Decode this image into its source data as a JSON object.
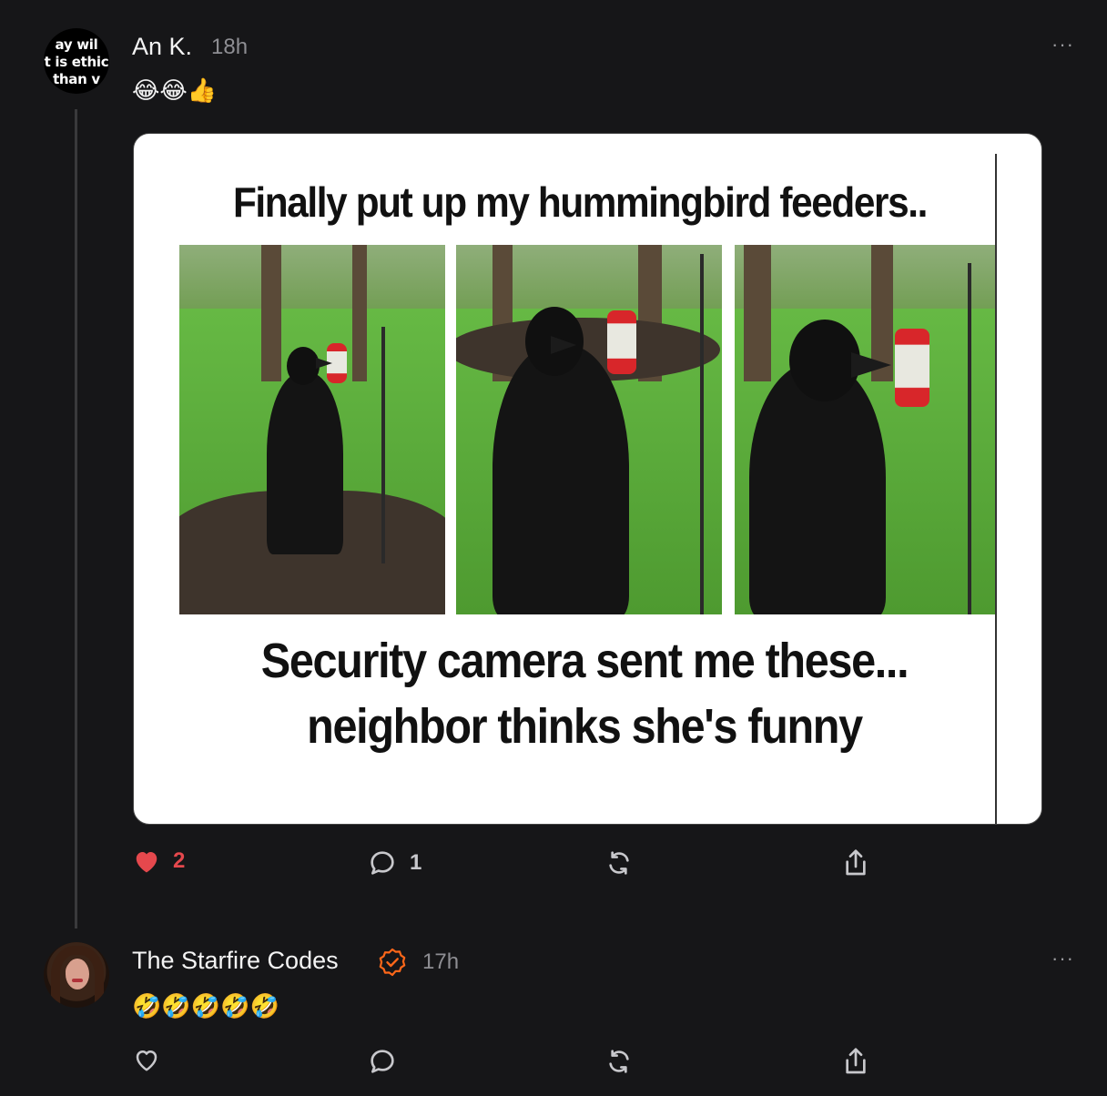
{
  "notes": [
    {
      "avatar_text": "ay wil\nt is ethic\nthan v",
      "author": "An K.",
      "time": "18h",
      "more": "···",
      "text": "😂😂👍",
      "image": {
        "caption_top": "Finally put up my hummingbird feeders..",
        "caption_bottom_line1": "Security camera sent me these...",
        "caption_bottom_line2": "neighbor thinks she's funny"
      },
      "actions": {
        "likes": "2",
        "comments": "1",
        "liked": true
      }
    },
    {
      "author": "The Starfire Codes",
      "verified": true,
      "time": "17h",
      "more": "···",
      "text": "🤣🤣🤣🤣🤣",
      "actions": {
        "likes": "",
        "comments": ""
      }
    }
  ],
  "icons": {
    "like": "heart-icon",
    "comment": "comment-bubble-icon",
    "restack": "restack-icon",
    "share": "share-icon",
    "verified": "verified-badge-icon",
    "more": "more-options-icon"
  },
  "colors": {
    "background": "#161618",
    "like_active": "#e5484d",
    "verified_badge": "#ff6719",
    "muted_text": "#8e8e93"
  }
}
